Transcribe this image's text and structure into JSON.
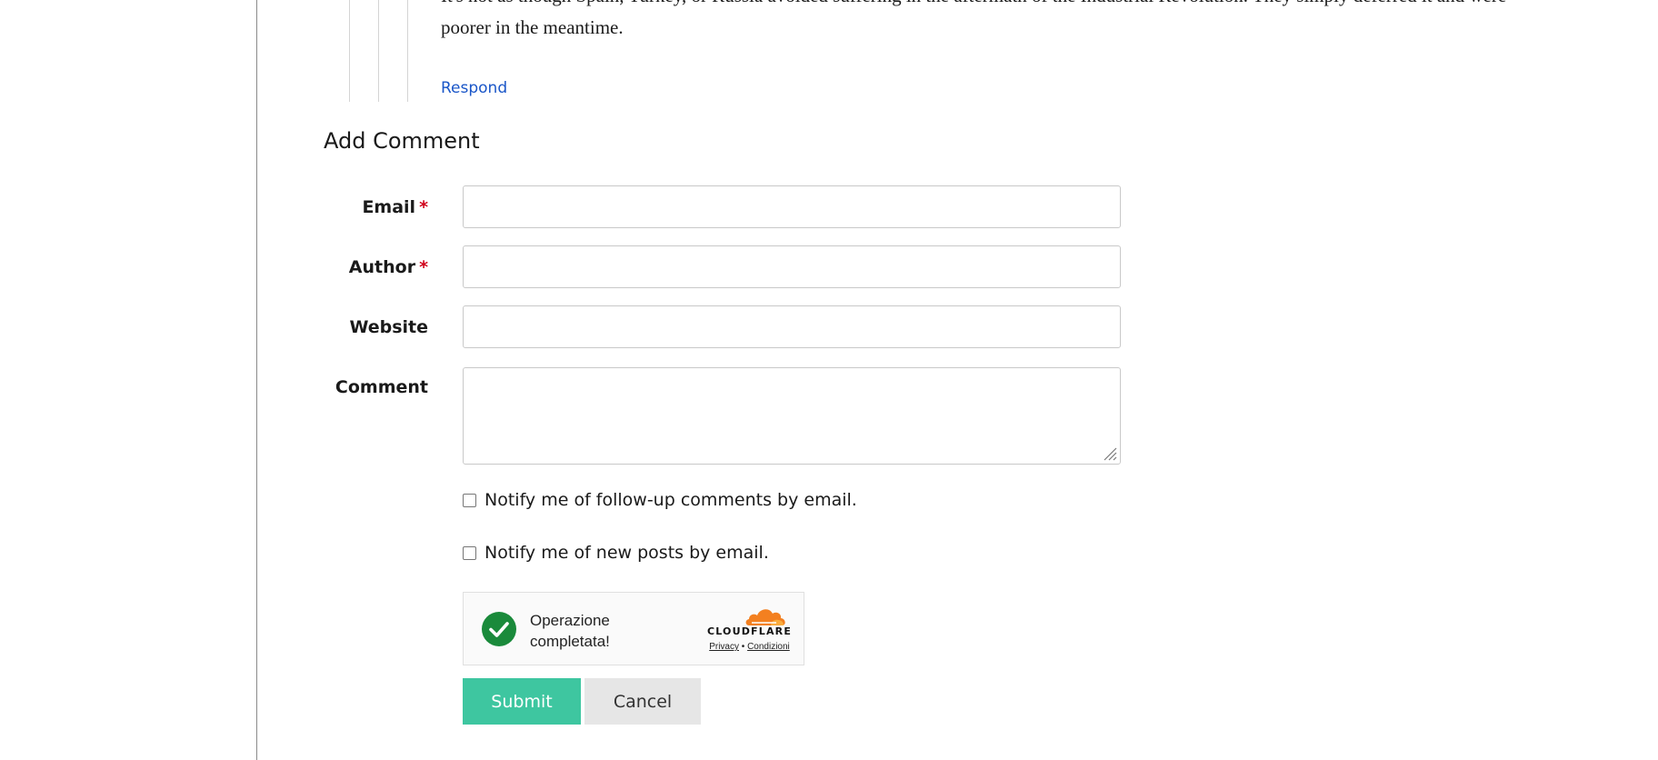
{
  "comment": {
    "text_line_1": "It's not as though Spain, Turkey, or Russia avoided suffering in the aftermath of the Industrial Revolution. They simply deferred it and were",
    "text_line_2": "poorer in the meantime.",
    "respond_label": "Respond"
  },
  "form": {
    "title": "Add Comment",
    "required_marker": "*",
    "email_label": "Email",
    "email_value": "",
    "author_label": "Author",
    "author_value": "",
    "website_label": "Website",
    "website_value": "",
    "comment_label": "Comment",
    "comment_value": "",
    "notify_followup_label": "Notify me of follow-up comments by email.",
    "notify_followup_checked": false,
    "notify_posts_label": "Notify me of new posts by email.",
    "notify_posts_checked": false,
    "submit_label": "Submit",
    "cancel_label": "Cancel"
  },
  "captcha": {
    "status_line_1": "Operazione",
    "status_line_2": "completata!",
    "brand": "CLOUDFLARE",
    "privacy_label": "Privacy",
    "separator": "•",
    "terms_label": "Condizioni",
    "success_icon": "check-circle-icon",
    "success_color": "#1a8a3b",
    "cloud_color": "#f38020"
  },
  "colors": {
    "accent_submit": "#3ec6a0",
    "link": "#1a56c8",
    "required": "#d0021b"
  }
}
